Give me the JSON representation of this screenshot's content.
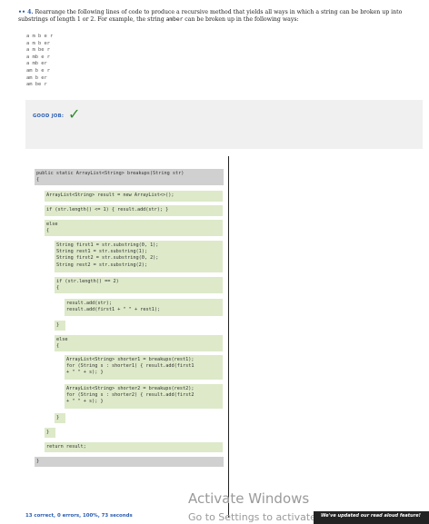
{
  "question": {
    "number": "4.",
    "prefix": "•• ",
    "text_before": "Rearrange the following lines of code to produce a recursive method that yields all ways in which a string can be broken up into substrings of length 1 or 2. For example, the string ",
    "example_word": "amber",
    "text_after": " can be broken up in the following ways:"
  },
  "examples": [
    "a m b e r",
    "a m b er",
    "a m be r",
    "a mb e r",
    "a mb er",
    "am b e r",
    "am b er",
    "am be r"
  ],
  "feedback": {
    "label": "GOOD JOB:",
    "check": "✓"
  },
  "code": {
    "header": "public static ArrayList<String> breakups(String str)",
    "open": "{",
    "result": "ArrayList<String> result = new ArrayList<>();",
    "if_base": "if (str.length() <= 1) { result.add(str); }",
    "else1": [
      "else",
      "{"
    ],
    "substrings": [
      "String first1 = str.substring(0, 1);",
      "String rest1 = str.substring(1);",
      "String first2 = str.substring(0, 2);",
      "String rest2 = str.substring(2);"
    ],
    "if_two": [
      "if (str.length() == 2)",
      "{"
    ],
    "adds": [
      "result.add(str);",
      "result.add(first1 + \" \" + rest1);"
    ],
    "close_if": "}",
    "else2": [
      "else",
      "{"
    ],
    "shorter1": [
      "ArrayList<String> shorter1 = breakups(rest1);",
      "for (String s : shorter1) { result.add(first1",
      "+ \" \" + s); }"
    ],
    "shorter2": [
      "ArrayList<String> shorter2 = breakups(rest2);",
      "for (String s : shorter2) { result.add(first2",
      "+ \" \" + s); }"
    ],
    "close_else2": "}",
    "close_else1": "}",
    "return": "return result;",
    "close": "}"
  },
  "status": "13 correct, 0 errors, 100%, 73 seconds",
  "watermark": {
    "line1": "Activate Windows",
    "line2": "Go to Settings to activate Windows."
  },
  "notice": "We've updated our read aloud feature!"
}
